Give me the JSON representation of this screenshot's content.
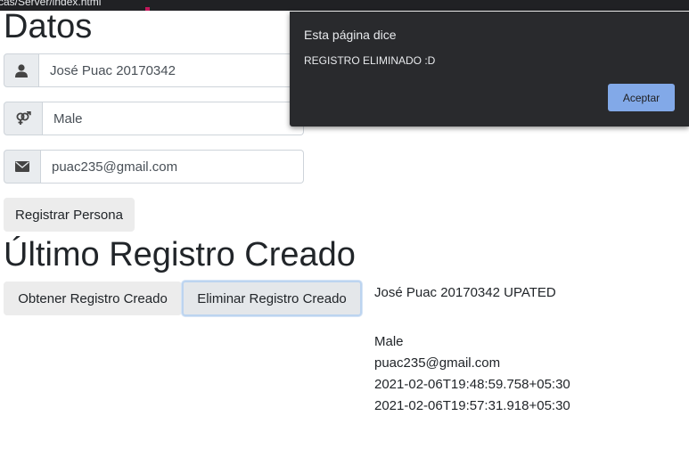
{
  "browser": {
    "url_fragment": "cas/Server/index.html"
  },
  "form": {
    "title": "Datos",
    "name_value": "José Puac 20170342",
    "gender_value": "Male",
    "email_value": "puac235@gmail.com",
    "register_button": "Registrar Persona"
  },
  "last_record": {
    "title": "Último Registro Creado",
    "get_button": "Obtener Registro Creado",
    "delete_button": "Eliminar Registro Creado",
    "lines": [
      "José Puac 20170342 UPATED",
      "Male",
      "puac235@gmail.com",
      "2021-02-06T19:48:59.758+05:30",
      "2021-02-06T19:57:31.918+05:30"
    ]
  },
  "dialog": {
    "title": "Esta página dice",
    "message": "REGISTRO ELIMINADO :D",
    "accept_button": "Aceptar"
  },
  "icons": [
    "user-icon",
    "gender-icon",
    "envelope-icon"
  ]
}
